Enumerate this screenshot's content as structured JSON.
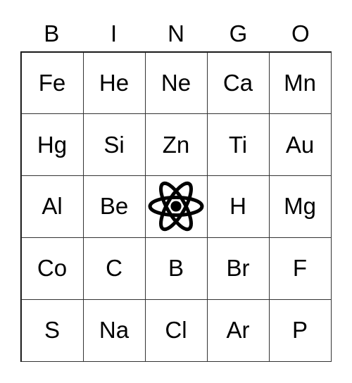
{
  "header": [
    "B",
    "I",
    "N",
    "G",
    "O"
  ],
  "rows": [
    [
      "Fe",
      "He",
      "Ne",
      "Ca",
      "Mn"
    ],
    [
      "Hg",
      "Si",
      "Zn",
      "Ti",
      "Au"
    ],
    [
      "Al",
      "Be",
      "",
      "H",
      "Mg"
    ],
    [
      "Co",
      "C",
      "B",
      "Br",
      "F"
    ],
    [
      "S",
      "Na",
      "Cl",
      "Ar",
      "P"
    ]
  ],
  "free_space_icon": "atom-icon"
}
